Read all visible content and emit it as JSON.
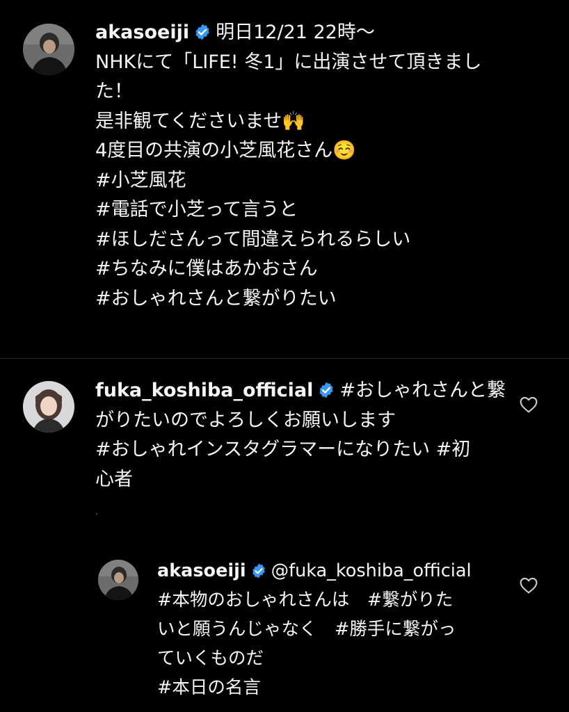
{
  "post": {
    "username": "akasoeiji",
    "lines": [
      "明日12/21 22時〜",
      "NHKにて「LIFE! 冬1」に出演させて頂きまし",
      "た！",
      "是非観てくださいませ🙌",
      "4度目の共演の小芝風花さん☺️",
      "#小芝風花",
      "#電話で小芝って言うと",
      "#ほしださんって間違えられるらしい",
      "#ちなみに僕はあかおさん",
      "#おしゃれさんと繋がりたい"
    ]
  },
  "comment": {
    "username": "fuka_koshiba_official",
    "lines": [
      "#おしゃれさんと繋",
      "がりたいのでよろしくお願いします",
      "#おしゃれインスタグラマーになりたい #初",
      "心者"
    ]
  },
  "reply": {
    "username": "akasoeiji",
    "lines": [
      "@fuka_koshiba_official",
      "#本物のおしゃれさんは　#繋がりた",
      "いと願うんじゃなく　#勝手に繋がっ",
      "ていくものだ",
      "#本日の名言"
    ]
  },
  "icons": {
    "verified": "verified-badge-icon",
    "like": "heart-icon"
  },
  "colors": {
    "background": "#000000",
    "text": "#f5f5f5",
    "verified": "#3897f0",
    "divider": "#262626"
  }
}
